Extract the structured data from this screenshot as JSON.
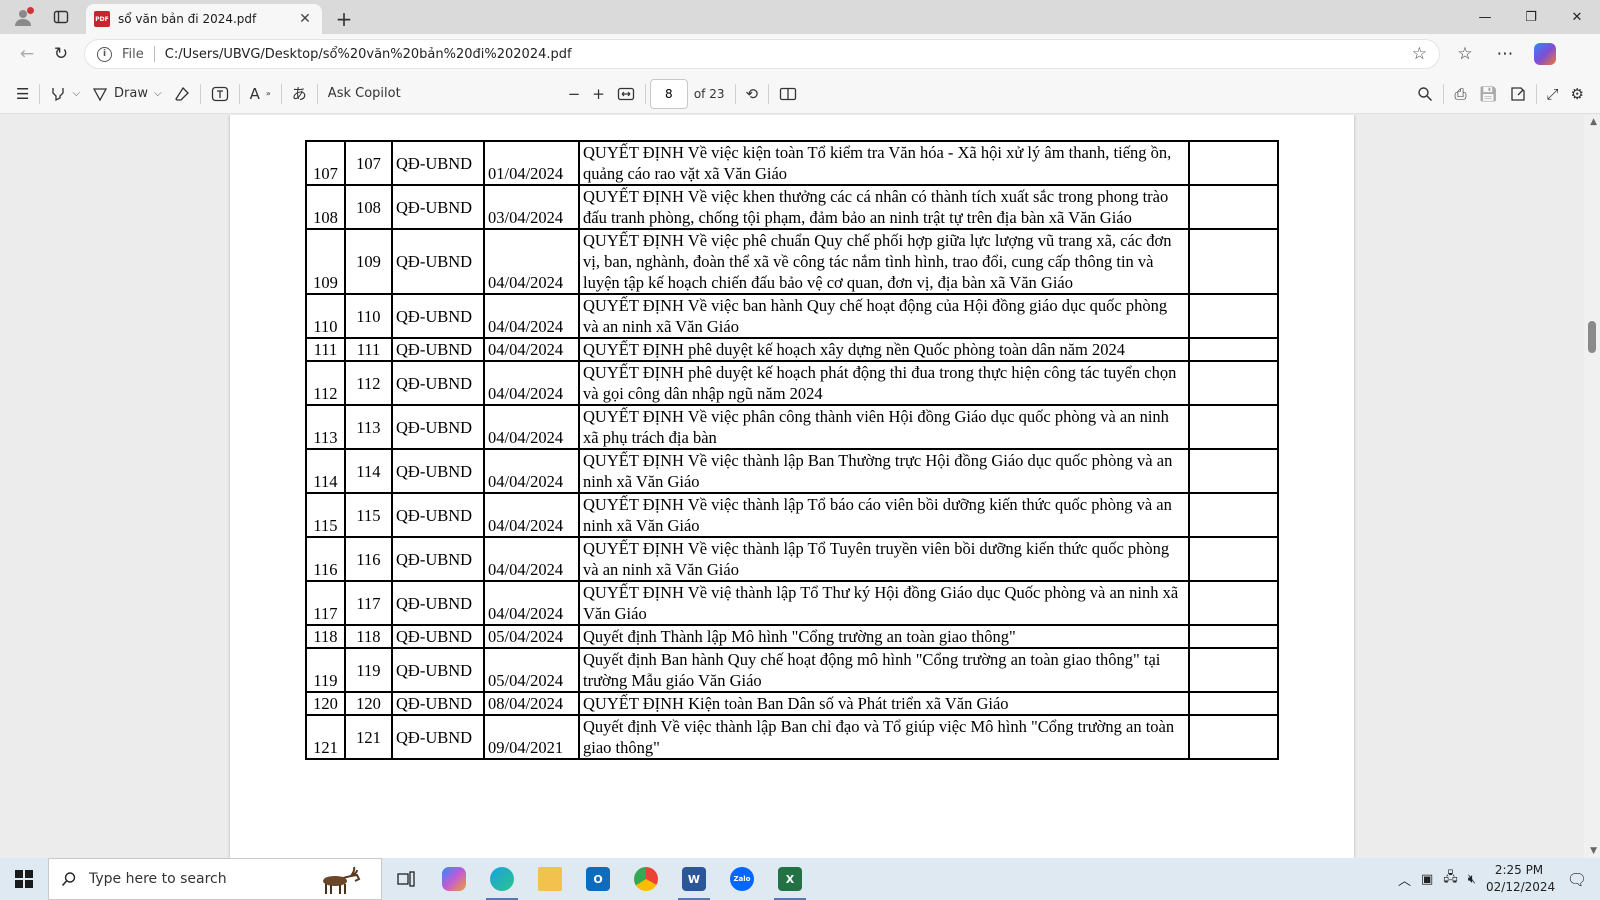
{
  "browser": {
    "tab_title": "sổ văn bản đi 2024.pdf",
    "file_label": "File",
    "url": "C:/Users/UBVG/Desktop/sổ%20văn%20bản%20đi%202024.pdf"
  },
  "pdf_toolbar": {
    "draw_label": "Draw",
    "ask_copilot_label": "Ask Copilot",
    "page_number": "8",
    "page_total": "of 23"
  },
  "table": {
    "rows": [
      {
        "stt": "107",
        "num": "107",
        "type": "QĐ-UBND",
        "date": "01/04/2024",
        "content": "QUYẾT ĐỊNH Về việc kiện toàn Tổ kiểm tra Văn hóa - Xã hội xử lý âm thanh, tiếng ồn, quảng cáo rao vặt xã Văn Giáo"
      },
      {
        "stt": "108",
        "num": "108",
        "type": "QĐ-UBND",
        "date": "03/04/2024",
        "content": "QUYẾT ĐỊNH Về việc khen thưởng các cá nhân có thành tích xuất sắc trong phong trào đấu tranh phòng, chống tội phạm, đảm bảo an ninh trật tự trên địa bàn xã Văn Giáo"
      },
      {
        "stt": "109",
        "num": "109",
        "type": "QĐ-UBND",
        "date": "04/04/2024",
        "content": "QUYẾT ĐỊNH Về việc phê chuẩn Quy chế phối hợp giữa lực lượng vũ trang xã, các đơn vị, ban, nghành, đoàn thể xã về công tác nắm tình hình, trao đổi, cung cấp thông tin và luyện tập kế hoạch chiến đấu bảo vệ cơ quan, đơn vị, địa bàn xã Văn Giáo"
      },
      {
        "stt": "110",
        "num": "110",
        "type": "QĐ-UBND",
        "date": "04/04/2024",
        "content": "QUYẾT ĐỊNH Về việc ban hành Quy chế hoạt động của Hội đồng giáo dục quốc phòng và an ninh xã Văn Giáo"
      },
      {
        "stt": "111",
        "num": "111",
        "type": "QĐ-UBND",
        "date": "04/04/2024",
        "content": "QUYẾT ĐỊNH phê duyệt kế hoạch xây dựng nền Quốc phòng toàn dân năm 2024"
      },
      {
        "stt": "112",
        "num": "112",
        "type": "QĐ-UBND",
        "date": "04/04/2024",
        "content": "QUYẾT ĐỊNH phê duyệt kế hoạch phát động thi đua trong thực hiện công tác tuyển chọn và gọi công dân nhập ngũ năm 2024"
      },
      {
        "stt": "113",
        "num": "113",
        "type": "QĐ-UBND",
        "date": "04/04/2024",
        "content": "QUYẾT ĐỊNH Về việc phân công thành viên Hội đồng Giáo dục quốc phòng và an ninh xã phụ trách địa bàn"
      },
      {
        "stt": "114",
        "num": "114",
        "type": "QĐ-UBND",
        "date": "04/04/2024",
        "content": "QUYẾT ĐỊNH Về việc thành lập Ban Thường trực Hội đồng Giáo dục quốc phòng và an ninh xã Văn Giáo"
      },
      {
        "stt": "115",
        "num": "115",
        "type": "QĐ-UBND",
        "date": "04/04/2024",
        "content": "QUYẾT ĐỊNH Về việc thành lập Tổ báo cáo viên bồi dưỡng kiến thức quốc phòng và an ninh xã Văn Giáo"
      },
      {
        "stt": "116",
        "num": "116",
        "type": "QĐ-UBND",
        "date": "04/04/2024",
        "content": "QUYẾT ĐỊNH Về việc thành lập Tổ Tuyên truyền viên bồi dưỡng kiến thức quốc phòng và an ninh xã Văn Giáo"
      },
      {
        "stt": "117",
        "num": "117",
        "type": "QĐ-UBND",
        "date": "04/04/2024",
        "content": "QUYẾT ĐỊNH Về việ thành lập Tổ Thư ký Hội đồng Giáo dục Quốc phòng và an ninh xã Văn Giáo"
      },
      {
        "stt": "118",
        "num": "118",
        "type": "QĐ-UBND",
        "date": "05/04/2024",
        "content": "Quyết định Thành lập Mô hình \"Cổng trường an toàn giao thông\""
      },
      {
        "stt": "119",
        "num": "119",
        "type": "QĐ-UBND",
        "date": "05/04/2024",
        "content": "Quyết định Ban hành Quy chế hoạt động mô hình \"Cổng trường an toàn giao thông\" tại trường Mẫu giáo Văn Giáo"
      },
      {
        "stt": "120",
        "num": "120",
        "type": "QĐ-UBND",
        "date": "08/04/2024",
        "content": "QUYẾT ĐỊNH Kiện toàn Ban Dân số và Phát triển xã Văn Giáo"
      },
      {
        "stt": "121",
        "num": "121",
        "type": "QĐ-UBND",
        "date": "09/04/2021",
        "content": "Quyết định Về việc thành lập Ban chỉ đạo và Tổ giúp việc Mô hình \"Cổng trường an toàn giao thông\""
      }
    ]
  },
  "taskbar": {
    "search_placeholder": "Type here to search",
    "time": "2:25 PM",
    "date": "02/12/2024"
  }
}
